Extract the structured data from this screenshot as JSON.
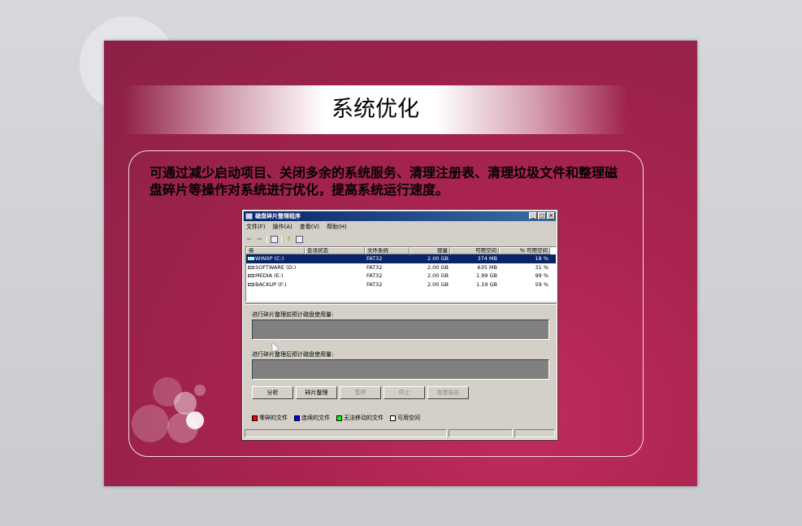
{
  "slide": {
    "title": "系统优化",
    "description": "可通过减少启动项目、关闭多余的系统服务、清理注册表、清理垃圾文件和整理磁盘碎片等操作对系统进行优化，提高系统运行速度。"
  },
  "dialog": {
    "title": "磁盘碎片整理程序",
    "title_buttons": [
      "_",
      "□",
      "×"
    ],
    "menu": [
      "文件(F)",
      "操作(A)",
      "查看(V)",
      "帮助(H)"
    ],
    "toolbar_icons": [
      "back-arrow-icon",
      "forward-arrow-icon",
      "properties-icon",
      "help-icon",
      "view-icon"
    ],
    "columns": [
      "卷",
      "会话状态",
      "文件系统",
      "容量",
      "可用空间",
      "% 可用空间"
    ],
    "rows": [
      {
        "volume": "WINXP (C:)",
        "session": "",
        "fs": "FAT32",
        "capacity": "2.00 GB",
        "free": "374 MB",
        "pct": "18 %",
        "selected": true
      },
      {
        "volume": "SOFTWARE (D:)",
        "session": "",
        "fs": "FAT32",
        "capacity": "2.00 GB",
        "free": "635 MB",
        "pct": "31 %",
        "selected": false
      },
      {
        "volume": "MEDIA (E:)",
        "session": "",
        "fs": "FAT32",
        "capacity": "2.00 GB",
        "free": "1.99 GB",
        "pct": "99 %",
        "selected": false
      },
      {
        "volume": "BACKUP (F:)",
        "session": "",
        "fs": "FAT32",
        "capacity": "2.00 GB",
        "free": "1.19 GB",
        "pct": "59 %",
        "selected": false
      }
    ],
    "before_label": "进行碎片整理前预计磁盘使用量:",
    "after_label": "进行碎片整理后预计磁盘使用量:",
    "buttons": [
      {
        "label": "分析",
        "enabled": true
      },
      {
        "label": "碎片整理",
        "enabled": true
      },
      {
        "label": "暂停",
        "enabled": false
      },
      {
        "label": "停止",
        "enabled": false
      },
      {
        "label": "查看报告",
        "enabled": false
      }
    ],
    "legend": [
      {
        "label": "零碎的文件",
        "color": "#ff0000"
      },
      {
        "label": "连续的文件",
        "color": "#0000ff"
      },
      {
        "label": "无法移动的文件",
        "color": "#00ff00"
      },
      {
        "label": "可用空间",
        "color": "#ffffff"
      }
    ]
  },
  "colors": {
    "slide_bg": "#8b2046",
    "selection": "#0a246a",
    "dialog_face": "#d4d0c8"
  }
}
